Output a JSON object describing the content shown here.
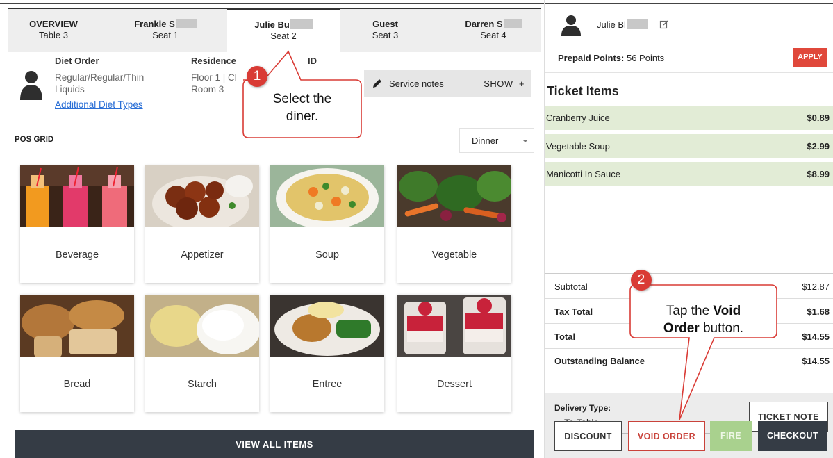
{
  "seat_tabs": [
    {
      "name": "OVERVIEW",
      "seat": "Table 3"
    },
    {
      "name": "Frankie S",
      "seat": "Seat 1"
    },
    {
      "name": "Julie Bu",
      "seat": "Seat 2"
    },
    {
      "name": "Guest",
      "seat": "Seat 3"
    },
    {
      "name": "Darren S",
      "seat": "Seat 4"
    }
  ],
  "diner_info": {
    "diet_order_label": "Diet Order",
    "diet_order_line1": "Regular/Regular/Thin",
    "diet_order_line2": "Liquids",
    "additional_link": "Additional Diet Types",
    "residence_label": "Residence",
    "residence_line1": "Floor 1 | Cl",
    "residence_line2": "Room 3",
    "id_label": "ID"
  },
  "service_notes": {
    "label": "Service notes",
    "toggle": "SHOW",
    "toggle_icon": "+"
  },
  "pos_grid": {
    "title": "POS GRID",
    "meal": "Dinner",
    "categories": [
      "Beverage",
      "Appetizer",
      "Soup",
      "Vegetable",
      "Bread",
      "Starch",
      "Entree",
      "Dessert"
    ],
    "view_all": "VIEW ALL ITEMS"
  },
  "ticket": {
    "diner_name": "Julie Bl",
    "prepaid_label": "Prepaid Points:",
    "prepaid_value": "56 Points",
    "apply_label": "APPLY",
    "title": "Ticket Items",
    "items": [
      {
        "name": "Cranberry Juice",
        "price": "$0.89"
      },
      {
        "name": "Vegetable Soup",
        "price": "$2.99"
      },
      {
        "name": "Manicotti In Sauce",
        "price": "$8.99"
      }
    ],
    "totals": [
      {
        "label": "Subtotal",
        "value": "$12.87"
      },
      {
        "label": "Tax Total",
        "value": "$1.68"
      },
      {
        "label": "Total",
        "value": "$14.55"
      },
      {
        "label": "Outstanding Balance",
        "value": "$14.55"
      }
    ],
    "delivery_label": "Delivery Type:",
    "delivery_value": "To Table",
    "buttons": {
      "ticket_note": "TICKET NOTE",
      "discount": "DISCOUNT",
      "void_order": "VOID ORDER",
      "fire": "FIRE",
      "checkout": "CHECKOUT"
    }
  },
  "callouts": [
    {
      "number": "1",
      "line1": "Select the",
      "line2": "diner."
    },
    {
      "number": "2",
      "line1_pre": "Tap the ",
      "line1_bold": "Void",
      "line2_bold": "Order",
      "line2_post": " button."
    }
  ],
  "colors": {
    "accent_red": "#d93b35",
    "ticket_green": "#e2ecd6",
    "dark_button": "#353c45",
    "fire_green": "#a9d18e"
  }
}
